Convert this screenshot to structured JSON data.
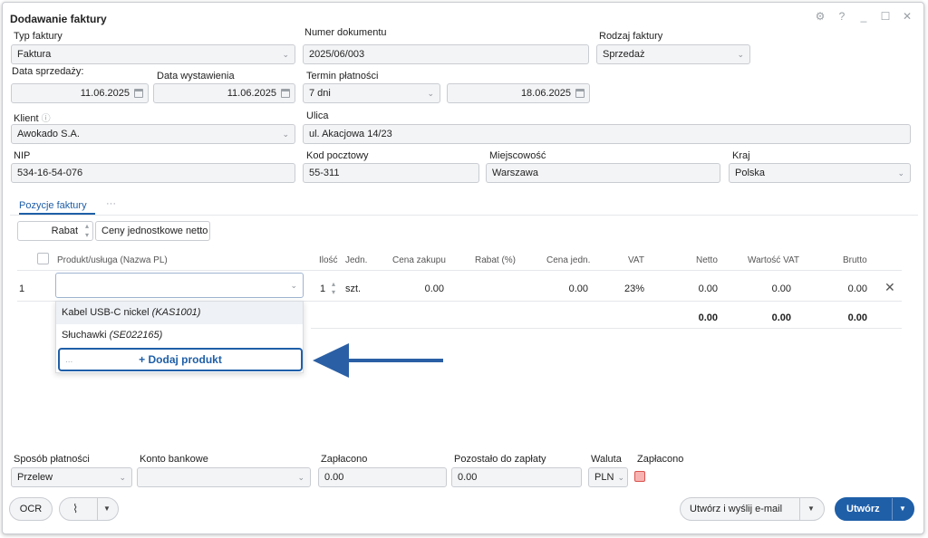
{
  "window": {
    "title": "Dodawanie faktury"
  },
  "header": {
    "typ_faktury": {
      "label": "Typ faktury",
      "value": "Faktura"
    },
    "numer_dokumentu": {
      "label": "Numer dokumentu",
      "value": "2025/06/003"
    },
    "rodzaj_faktury": {
      "label": "Rodzaj faktury",
      "value": "Sprzedaż"
    },
    "data_sprzedazy": {
      "label": "Data sprzedaży:",
      "value": "11.06.2025"
    },
    "data_wystawienia": {
      "label": "Data wystawienia",
      "value": "11.06.2025"
    },
    "termin_platnosci": {
      "label": "Termin płatności",
      "value": "7 dni",
      "date": "18.06.2025"
    },
    "klient": {
      "label": "Klient",
      "value": "Awokado S.A."
    },
    "ulica": {
      "label": "Ulica",
      "value": "ul. Akacjowa 14/23"
    },
    "nip": {
      "label": "NIP",
      "value": "534-16-54-076"
    },
    "kod_pocztowy": {
      "label": "Kod pocztowy",
      "value": "55-311"
    },
    "miejscowosc": {
      "label": "Miejscowość",
      "value": "Warszawa"
    },
    "kraj": {
      "label": "Kraj",
      "value": "Polska"
    }
  },
  "tabs": {
    "active": "Pozycje faktury",
    "more": "···"
  },
  "toolbar": {
    "rabat": "Rabat",
    "ceny": "Ceny jednostkowe netto"
  },
  "table": {
    "headers": {
      "product": "Produkt/usługa (Nazwa PL)",
      "qty": "Ilość",
      "unit": "Jedn.",
      "purchase_price": "Cena zakupu",
      "discount": "Rabat (%)",
      "unit_price": "Cena jedn.",
      "vat": "VAT",
      "netto": "Netto",
      "vat_value": "Wartość VAT",
      "brutto": "Brutto"
    },
    "row": {
      "lp": "1",
      "qty": "1",
      "unit": "szt.",
      "purchase_price": "0.00",
      "unit_price": "0.00",
      "vat": "23%",
      "netto": "0.00",
      "vat_value": "0.00",
      "brutto": "0.00"
    },
    "totals": {
      "netto": "0.00",
      "vat_value": "0.00",
      "brutto": "0.00"
    }
  },
  "dropdown": {
    "items": [
      {
        "name": "Kabel USB-C nickel",
        "code": "(KAS1001)"
      },
      {
        "name": "Słuchawki",
        "code": "(SE022165)"
      }
    ],
    "add_placeholder": "...",
    "add_label": "+ Dodaj produkt"
  },
  "payment": {
    "sposob": {
      "label": "Sposób płatności",
      "value": "Przelew"
    },
    "konto": {
      "label": "Konto bankowe",
      "value": ""
    },
    "zaplacono": {
      "label": "Zapłacono",
      "value": "0.00"
    },
    "pozostalo": {
      "label": "Pozostało do zapłaty",
      "value": "0.00"
    },
    "waluta": {
      "label": "Waluta",
      "value": "PLN"
    },
    "zaplacono_check": {
      "label": "Zapłacono"
    }
  },
  "footer": {
    "ocr": "OCR",
    "send": "Utwórz i wyślij e-mail",
    "create": "Utwórz"
  },
  "colors": {
    "accent": "#1f5fa8",
    "arrow": "#2a5fa5"
  }
}
